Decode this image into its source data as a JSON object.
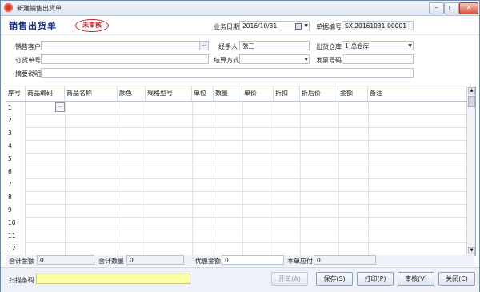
{
  "window": {
    "title": "新建销售出货单",
    "min": "–",
    "max": "□",
    "close": "✕"
  },
  "header": {
    "doc_title": "销售出货单",
    "stamp": "未审核"
  },
  "form": {
    "biz_date_label": "业务日期",
    "biz_date_value": "2016/10/31",
    "doc_no_label": "单据编号",
    "doc_no_value": "SX.20161031-00001",
    "customer_label": "销售客户",
    "customer_value": "",
    "handler_label": "经手人",
    "handler_value": "张三",
    "warehouse_label": "出货仓库",
    "warehouse_value": "1)总仓库",
    "order_no_label": "订货单号",
    "order_no_value": "",
    "settle_label": "结算方式",
    "settle_value": "",
    "invoice_label": "发票号码",
    "invoice_value": "",
    "remark_label": "摘要说明",
    "remark_value": ""
  },
  "grid": {
    "columns": [
      "序号",
      "商品编码",
      "商品名称",
      "颜色",
      "规格型号",
      "单位",
      "数量",
      "单价",
      "折扣",
      "折后价",
      "金额",
      "备注"
    ],
    "rows": [
      "1",
      "2",
      "3",
      "4",
      "5",
      "6",
      "7",
      "8",
      "9",
      "10",
      "11",
      "12"
    ],
    "cell_button": "..."
  },
  "summary": {
    "total_amount_label": "合计金额",
    "total_amount_value": "0",
    "total_qty_label": "合计数量",
    "total_qty_value": "0",
    "discount_label": "优惠金额",
    "discount_value": "0",
    "payable_label": "本单应付",
    "payable_value": "0"
  },
  "footer": {
    "scan_label": "扫描条码",
    "scan_value": "",
    "new_label": "开单(A)",
    "save_label": "保存(S)",
    "print_label": "打印(P)",
    "audit_label": "审核(V)",
    "close_label": "关闭(C)"
  }
}
